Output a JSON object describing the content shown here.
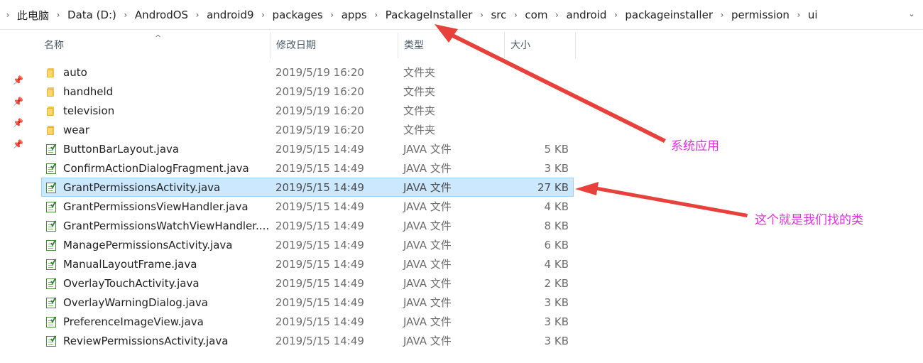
{
  "breadcrumb": [
    "此电脑",
    "Data (D:)",
    "AndrodOS",
    "android9",
    "packages",
    "apps",
    "PackageInstaller",
    "src",
    "com",
    "android",
    "packageinstaller",
    "permission",
    "ui"
  ],
  "columns": {
    "name": "名称",
    "date": "修改日期",
    "type": "类型",
    "size": "大小"
  },
  "files": [
    {
      "name": "auto",
      "date": "2019/5/19 16:20",
      "type": "文件夹",
      "size": "",
      "kind": "folder"
    },
    {
      "name": "handheld",
      "date": "2019/5/19 16:20",
      "type": "文件夹",
      "size": "",
      "kind": "folder"
    },
    {
      "name": "television",
      "date": "2019/5/19 16:20",
      "type": "文件夹",
      "size": "",
      "kind": "folder"
    },
    {
      "name": "wear",
      "date": "2019/5/19 16:20",
      "type": "文件夹",
      "size": "",
      "kind": "folder"
    },
    {
      "name": "ButtonBarLayout.java",
      "date": "2019/5/15 14:49",
      "type": "JAVA 文件",
      "size": "5 KB",
      "kind": "java"
    },
    {
      "name": "ConfirmActionDialogFragment.java",
      "date": "2019/5/15 14:49",
      "type": "JAVA 文件",
      "size": "3 KB",
      "kind": "java"
    },
    {
      "name": "GrantPermissionsActivity.java",
      "date": "2019/5/15 14:49",
      "type": "JAVA 文件",
      "size": "27 KB",
      "kind": "java",
      "selected": true
    },
    {
      "name": "GrantPermissionsViewHandler.java",
      "date": "2019/5/15 14:49",
      "type": "JAVA 文件",
      "size": "4 KB",
      "kind": "java"
    },
    {
      "name": "GrantPermissionsWatchViewHandler....",
      "date": "2019/5/15 14:49",
      "type": "JAVA 文件",
      "size": "8 KB",
      "kind": "java"
    },
    {
      "name": "ManagePermissionsActivity.java",
      "date": "2019/5/15 14:49",
      "type": "JAVA 文件",
      "size": "6 KB",
      "kind": "java"
    },
    {
      "name": "ManualLayoutFrame.java",
      "date": "2019/5/15 14:49",
      "type": "JAVA 文件",
      "size": "4 KB",
      "kind": "java"
    },
    {
      "name": "OverlayTouchActivity.java",
      "date": "2019/5/15 14:49",
      "type": "JAVA 文件",
      "size": "2 KB",
      "kind": "java"
    },
    {
      "name": "OverlayWarningDialog.java",
      "date": "2019/5/15 14:49",
      "type": "JAVA 文件",
      "size": "3 KB",
      "kind": "java"
    },
    {
      "name": "PreferenceImageView.java",
      "date": "2019/5/15 14:49",
      "type": "JAVA 文件",
      "size": "3 KB",
      "kind": "java"
    },
    {
      "name": "ReviewPermissionsActivity.java",
      "date": "2019/5/15 14:49",
      "type": "JAVA 文件",
      "size": "3 KB",
      "kind": "java"
    }
  ],
  "annotations": {
    "system_app": "系统应用",
    "target_class": "这个就是我们找的类"
  },
  "colors": {
    "selection_bg": "#cce8ff",
    "selection_border": "#99d1ff",
    "annotation_text": "#e230e2",
    "arrow": "#e8413c"
  }
}
